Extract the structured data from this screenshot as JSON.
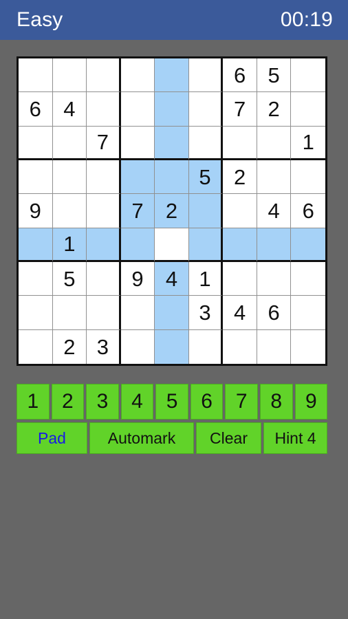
{
  "header": {
    "difficulty": "Easy",
    "timer": "00:19",
    "background_color": "#3b5a9a",
    "text_color": "#ffffff"
  },
  "app": {
    "background_color": "#666666"
  },
  "board": {
    "size": 9,
    "cell_background": "#ffffff",
    "highlight_color": "#a6d2f7",
    "selected_cell": {
      "row": 6,
      "col": 5
    },
    "grid_line_color": "#909090",
    "box_line_color": "#111111",
    "rows": [
      [
        "",
        "",
        "",
        "",
        "",
        "",
        "6",
        "5",
        ""
      ],
      [
        "6",
        "4",
        "",
        "",
        "",
        "",
        "7",
        "2",
        ""
      ],
      [
        "",
        "",
        "7",
        "",
        "",
        "",
        "",
        "",
        "1"
      ],
      [
        "",
        "",
        "",
        "",
        "",
        "5",
        "2",
        "",
        ""
      ],
      [
        "9",
        "",
        "",
        "7",
        "2",
        "",
        "",
        "4",
        "6"
      ],
      [
        "",
        "1",
        "",
        "",
        "",
        "",
        "",
        "",
        ""
      ],
      [
        "",
        "5",
        "",
        "9",
        "4",
        "1",
        "",
        "",
        ""
      ],
      [
        "",
        "",
        "",
        "",
        "",
        "3",
        "4",
        "6",
        ""
      ],
      [
        "",
        "2",
        "3",
        "",
        "",
        "",
        "",
        "",
        ""
      ]
    ],
    "highlighted": [
      [
        false,
        false,
        false,
        false,
        true,
        false,
        false,
        false,
        false
      ],
      [
        false,
        false,
        false,
        false,
        true,
        false,
        false,
        false,
        false
      ],
      [
        false,
        false,
        false,
        false,
        true,
        false,
        false,
        false,
        false
      ],
      [
        false,
        false,
        false,
        true,
        true,
        true,
        false,
        false,
        false
      ],
      [
        false,
        false,
        false,
        true,
        true,
        true,
        false,
        false,
        false
      ],
      [
        true,
        true,
        true,
        true,
        false,
        true,
        true,
        true,
        true
      ],
      [
        false,
        false,
        false,
        false,
        true,
        false,
        false,
        false,
        false
      ],
      [
        false,
        false,
        false,
        false,
        true,
        false,
        false,
        false,
        false
      ],
      [
        false,
        false,
        false,
        false,
        true,
        false,
        false,
        false,
        false
      ]
    ]
  },
  "numpad": {
    "button_color": "#61d329",
    "text_color": "#111111",
    "keys": [
      "1",
      "2",
      "3",
      "4",
      "5",
      "6",
      "7",
      "8",
      "9"
    ]
  },
  "controls": {
    "button_color": "#61d329",
    "pad": {
      "label": "Pad",
      "text_color": "#1919e6"
    },
    "automark": {
      "label": "Automark",
      "text_color": "#111111"
    },
    "clear": {
      "label": "Clear",
      "text_color": "#111111"
    },
    "hint": {
      "label": "Hint 4",
      "text_color": "#111111"
    }
  }
}
